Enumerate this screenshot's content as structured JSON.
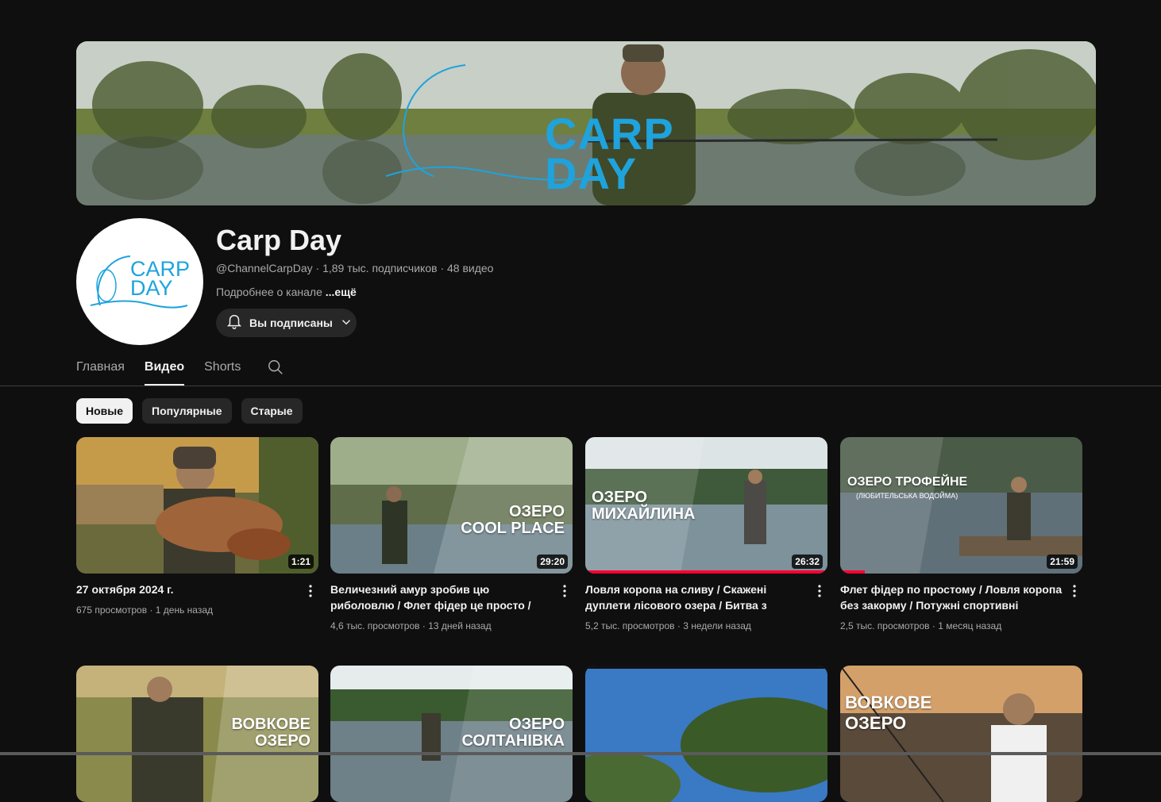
{
  "banner": {
    "logo_line1": "CARP",
    "logo_line2": "DAY"
  },
  "channel": {
    "avatar_line1": "CARP",
    "avatar_line2": "DAY",
    "title": "Carp Day",
    "handle": "@ChannelCarpDay",
    "subscribers": "1,89 тыс. подписчиков",
    "videos_count": "48 видео",
    "description": "Подробнее о канале",
    "more_label": "...ещё",
    "subscribe_label": "Вы подписаны"
  },
  "tabs": [
    {
      "label": "Главная",
      "active": false
    },
    {
      "label": "Видео",
      "active": true
    },
    {
      "label": "Shorts",
      "active": false
    }
  ],
  "chips": [
    {
      "label": "Новые",
      "active": true
    },
    {
      "label": "Популярные",
      "active": false
    },
    {
      "label": "Старые",
      "active": false
    }
  ],
  "videos": [
    {
      "title": "27 октября 2024 г.",
      "views": "675 просмотров",
      "age": "1 день назад",
      "duration": "1:21",
      "overlay": ""
    },
    {
      "title": "Величезний амур зробив цю риболовлю / Флет фідер це просто / Озеро Cool Place",
      "views": "4,6 тыс. просмотров",
      "age": "13 дней назад",
      "duration": "29:20",
      "overlay_line1": "ОЗЕРО",
      "overlay_line2": "COOL PLACE"
    },
    {
      "title": "Ловля коропа на сливу / Скажені дуплети лісового озера / Битва з корчами",
      "views": "5,2 тыс. просмотров",
      "age": "3 недели назад",
      "duration": "26:32",
      "overlay_line1": "ОЗЕРО",
      "overlay_line2": "МИХАЙЛИНА",
      "progress": 1.0
    },
    {
      "title": "Флет фідер по простому / Ловля коропа без закорму / Потужні спортивні коропи...",
      "views": "2,5 тыс. просмотров",
      "age": "1 месяц назад",
      "duration": "21:59",
      "overlay_line1": "ОЗЕРО ТРОФЕЙНЕ",
      "overlay_line2": "(ЛЮБИТЕЛЬСЬКА ВОДОЙМА)",
      "progress": 0.1
    },
    {
      "overlay_line1": "ВОВКОВЕ",
      "overlay_line2": "ОЗЕРО"
    },
    {
      "overlay_line1": "ОЗЕРО",
      "overlay_line2": "СОЛТАНІВКА"
    },
    {
      "overlay_line1": "",
      "overlay_line2": ""
    },
    {
      "overlay_line1": "ВОВКОВЕ",
      "overlay_line2": "ОЗЕРО"
    }
  ]
}
